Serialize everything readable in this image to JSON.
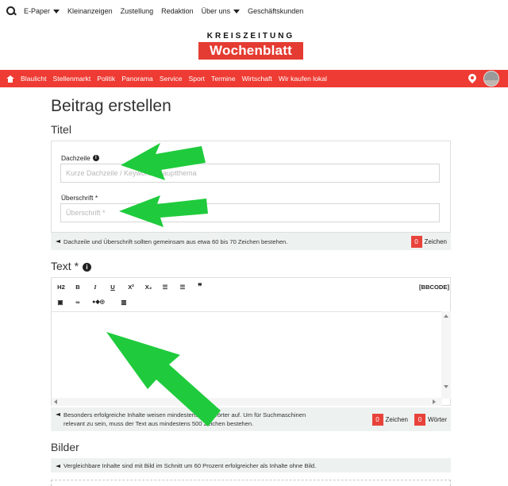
{
  "topbar": {
    "items": [
      {
        "label": "E-Paper",
        "dropdown": true
      },
      {
        "label": "Kleinanzeigen",
        "dropdown": false
      },
      {
        "label": "Zustellung",
        "dropdown": false
      },
      {
        "label": "Redaktion",
        "dropdown": false
      },
      {
        "label": "Über uns",
        "dropdown": true
      },
      {
        "label": "Geschäftskunden",
        "dropdown": false
      }
    ]
  },
  "logo": {
    "top": "KREISZEITUNG",
    "main": "Wochenblatt"
  },
  "nav": {
    "items": [
      "Blaulicht",
      "Stellenmarkt",
      "Politik",
      "Panorama",
      "Service",
      "Sport",
      "Termine",
      "Wirtschaft",
      "Wir kaufen lokal"
    ]
  },
  "page": {
    "title": "Beitrag erstellen"
  },
  "titel_section": {
    "heading": "Titel",
    "dachzeile": {
      "label": "Dachzeile",
      "placeholder": "Kurze Dachzeile / Keyword / Hauptthema"
    },
    "ueberschrift": {
      "label": "Überschrift *",
      "placeholder": "Überschrift *"
    },
    "hint": "Dachzeile und Überschrift sollten gemeinsam aus etwa 60 bis 70 Zeichen bestehen.",
    "count": "0",
    "count_label": "Zeichen"
  },
  "text_section": {
    "heading": "Text *",
    "toolbar": [
      "H2",
      "B",
      "I",
      "U",
      "X²",
      "X₂",
      "bullet-list",
      "numbered-list",
      "quote"
    ],
    "toolbar_row2": [
      "youtube",
      "link",
      "social",
      "map"
    ],
    "bbcode": "[BBCODE]",
    "hint_line1": "Besonders erfolgreiche Inhalte weisen mindestens 300 Wörter auf. Um für Suchmaschinen",
    "hint_line2": "relevant zu sein, muss der Text aus mindestens 500 Zeichen bestehen.",
    "char_count": "0",
    "char_label": "Zeichen",
    "word_count": "0",
    "word_label": "Wörter"
  },
  "bilder_section": {
    "heading": "Bilder",
    "hint": "Vergleichbare Inhalte sind mit Bild im Schnitt um 60 Prozent erfolgreicher als Inhalte ohne Bild."
  },
  "colors": {
    "brand_red": "#ee3b33",
    "arrow_green": "#1fcb3c",
    "hint_bg": "#edf2f0"
  }
}
